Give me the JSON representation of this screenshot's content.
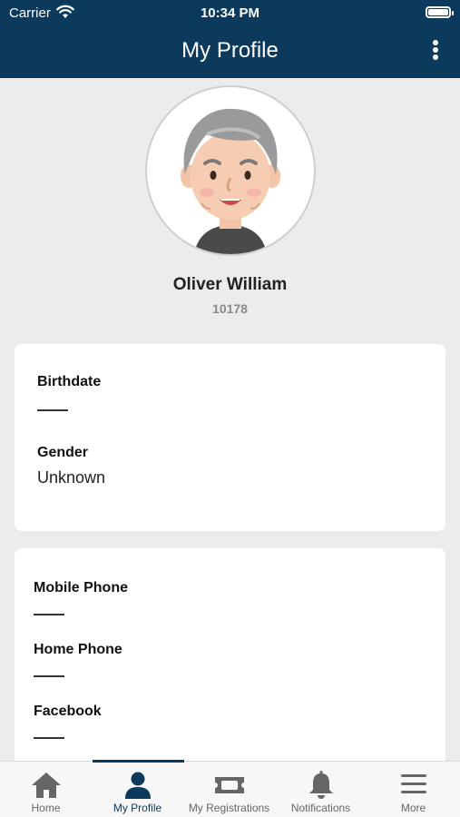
{
  "status_bar": {
    "carrier": "Carrier",
    "time": "10:34 PM"
  },
  "header": {
    "title": "My Profile",
    "menu_icon": "more-vertical-icon"
  },
  "profile": {
    "name": "Oliver William",
    "id": "10178",
    "avatar_icon": "elderly-man-avatar"
  },
  "personal": {
    "birthdate_label": "Birthdate",
    "birthdate_value": "",
    "gender_label": "Gender",
    "gender_value": "Unknown"
  },
  "contact": {
    "mobile_label": "Mobile Phone",
    "home_label": "Home Phone",
    "facebook_label": "Facebook"
  },
  "tabs": [
    {
      "label": "Home",
      "icon": "home-icon"
    },
    {
      "label": "My Profile",
      "icon": "person-icon"
    },
    {
      "label": "My Registrations",
      "icon": "ticket-icon"
    },
    {
      "label": "Notifications",
      "icon": "bell-icon"
    },
    {
      "label": "More",
      "icon": "menu-icon"
    }
  ],
  "colors": {
    "brand": "#0b3a5c",
    "background": "#ececec",
    "inactive_tab": "#666666"
  }
}
